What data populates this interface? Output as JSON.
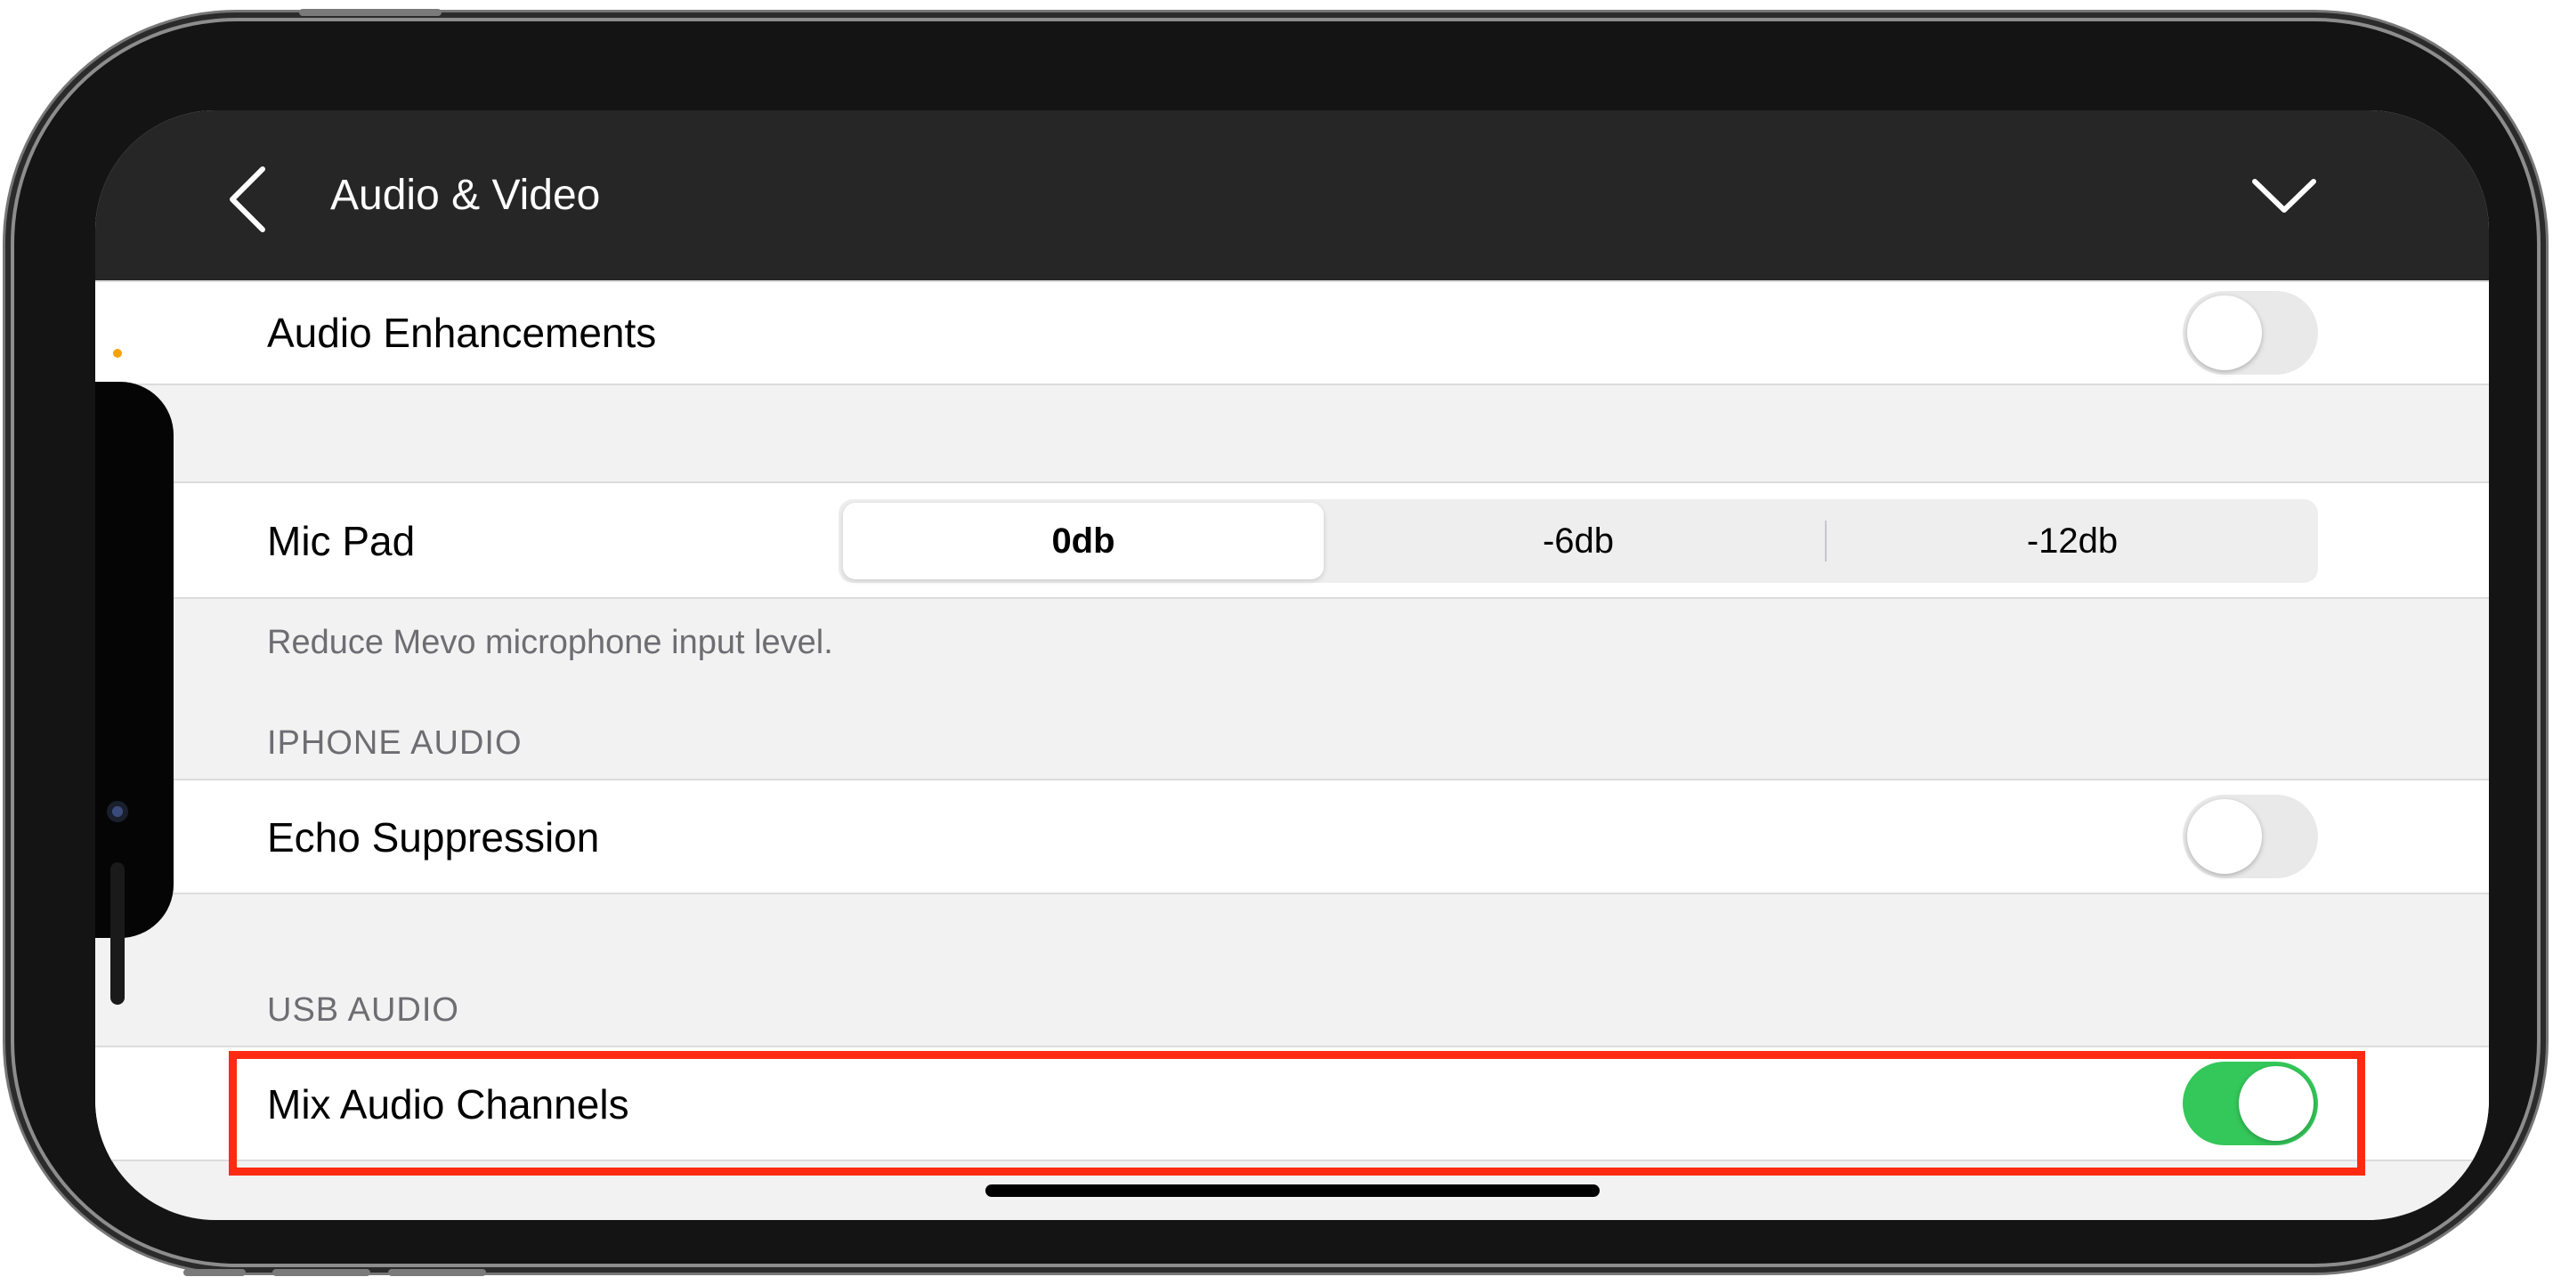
{
  "header": {
    "title": "Audio & Video",
    "back_icon": "chevron-left-icon",
    "collapse_icon": "chevron-down-icon"
  },
  "settings": {
    "audio_enhancements": {
      "label": "Audio Enhancements",
      "enabled": false
    },
    "mic_pad": {
      "label": "Mic Pad",
      "options": [
        "0db",
        "-6db",
        "-12db"
      ],
      "selected": "0db",
      "footnote": "Reduce Mevo microphone input level."
    },
    "iphone_audio": {
      "header": "IPHONE AUDIO",
      "echo_suppression": {
        "label": "Echo Suppression",
        "enabled": false
      }
    },
    "usb_audio": {
      "header": "USB AUDIO",
      "mix_audio_channels": {
        "label": "Mix Audio Channels",
        "enabled": true
      }
    }
  },
  "colors": {
    "toggle_on": "#34c759",
    "toggle_off": "#e9e9ea",
    "highlight_border": "#ff2a12",
    "header_bg": "#262626"
  }
}
